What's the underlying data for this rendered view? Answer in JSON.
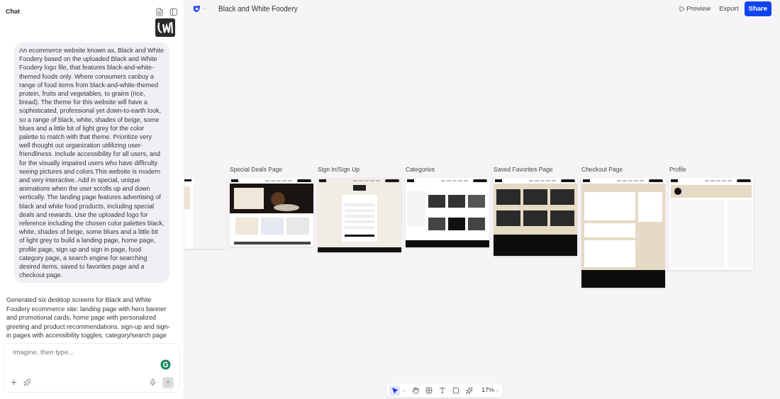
{
  "chat": {
    "title": "Chat",
    "user_message": "An ecommerce website known as, Black and White Foodery based on the uploaded Black and White Foodery logo file, that features black-and-white-themed foods only. Where consumers canbuy a range of food items from black-and-white-themed protein, fruits and vegetables, to grains (rice, bread). The theme for this website will have a sophisticated, professional yet down-to-earth look, so a range of black, white, shades of beige, some blues and a little bit of light grey for the color palette to match with that theme. Prioritize very well thought out organization utililizing user-friendliness. Include accessibility for all users, and for the visually impaired users who have difficulty seeing pictures and colors.This website is modern and very interactive. Add in special, unique animations when the user scrolls up and down vertically. The landing page features advertising of black and white food products, including special deals and rewards. Use the uploaded logo for reference including the chosen color palettes black, white, shades of beige, some blues and a little bit of light grey to build a landing page, home page, profile page, sign up and sign in page, food category page, a search engine for searching desired items, saved to favorites page and a checkout page.",
    "assistant_message": "Generated six desktop screens for Black and White Foodery ecommerce site: landing page with hero banner and promotional cards, home page with personalized greeting and product recommendations, sign-up and sign-in pages with accessibility toggles, category/search page",
    "input": {
      "placeholder": "Imagine, then type..."
    }
  },
  "project": {
    "title": "Black and White Foodery"
  },
  "header_actions": [
    {
      "kind": "preview",
      "label": "Preview"
    },
    {
      "kind": "plain",
      "label": "Export"
    },
    {
      "kind": "primary",
      "label": "Share"
    }
  ],
  "artboards": [
    {
      "kind": "landing"
    },
    {
      "kind": "deals",
      "label": "Special Deals Page"
    },
    {
      "kind": "signin",
      "label": "Sign In/Sign Up"
    },
    {
      "kind": "categories",
      "label": "Categories"
    },
    {
      "kind": "favorites",
      "label": "Saved Favorites Page"
    },
    {
      "kind": "checkout",
      "label": "Checkout Page"
    },
    {
      "kind": "profile",
      "label": "Profile"
    }
  ],
  "tools": [
    {
      "kind": "pointer",
      "selected": true
    },
    {
      "kind": "hand",
      "selected": false
    },
    {
      "kind": "frame",
      "selected": false
    },
    {
      "kind": "text",
      "selected": false
    },
    {
      "kind": "rectangle",
      "selected": false
    },
    {
      "kind": "component",
      "selected": false
    }
  ],
  "zoom": "17%"
}
